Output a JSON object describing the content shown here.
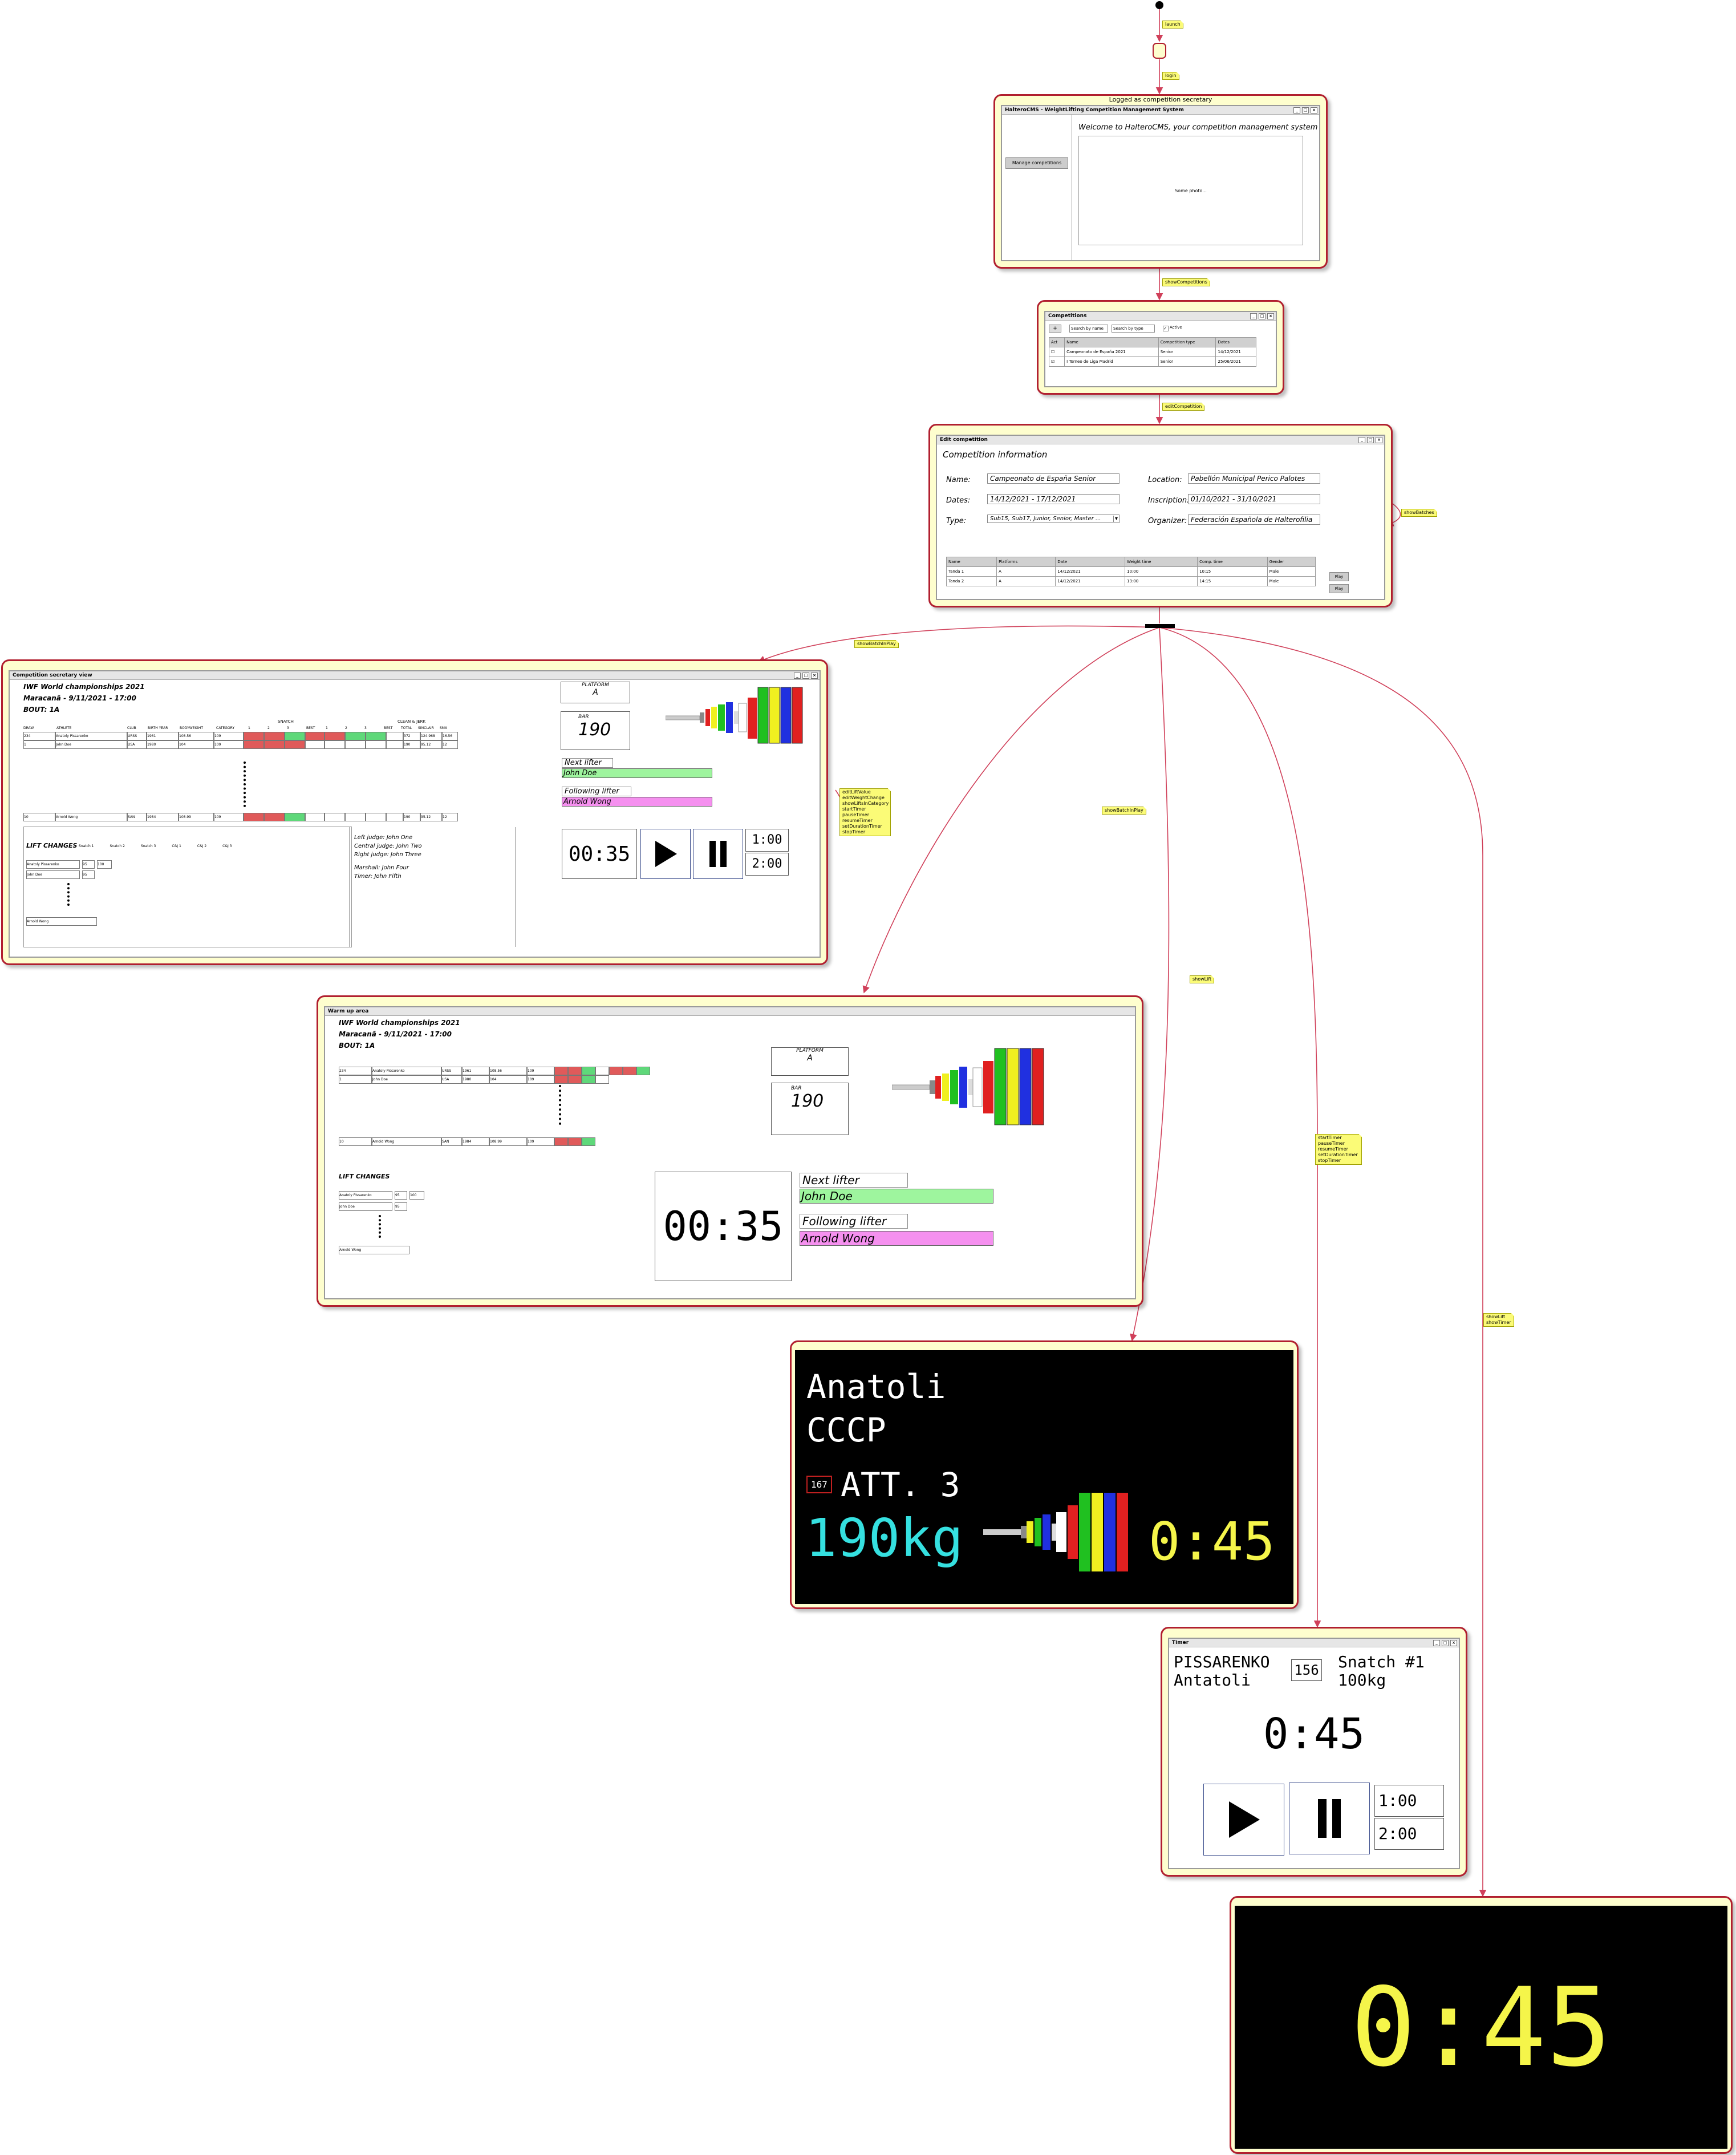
{
  "flow": {
    "notes": {
      "launch": "launch",
      "login": "login",
      "showCompetitions": "showCompetitions",
      "editCompetition": "editCompetition",
      "showBatches": "showBatches",
      "showBatchInPlay_1": "showBatchInPlay",
      "showBatchInPlay_2": "showBatchInPlay",
      "showLift": "showLift",
      "secretary_events": [
        "editLiftValue",
        "editWeightChange",
        "showLiftsInCategory",
        "startTimer",
        "pauseTimer",
        "resumeTimer",
        "setDurationTimer",
        "stopTimer"
      ],
      "timer_events": [
        "startTimer",
        "pauseTimer",
        "resumeTimer",
        "setDurationTimer",
        "stopTimer"
      ],
      "lift_timer_events": [
        "showLift",
        "showTimer"
      ]
    },
    "logged_state_title": "Logged as competition secretary"
  },
  "home_window": {
    "title": "HalteroCMS - WeightLifting Competition Management System",
    "manage_button": "Manage competitions",
    "welcome": "Welcome to HalteroCMS, your competition management system",
    "photo_placeholder": "Some photo..."
  },
  "competitions_window": {
    "title": "Competitions",
    "add_button": "+",
    "search_name": "Search by name",
    "search_type": "Search by type",
    "filter_label": "Active",
    "columns": [
      "Act",
      "Name",
      "Competition type",
      "Dates"
    ],
    "rows": [
      {
        "name": "Campeonato de España 2021",
        "type": "Senior",
        "dates": "14/12/2021"
      },
      {
        "name": "I Torneo de Liga Madrid",
        "type": "Senior",
        "dates": "25/06/2021"
      }
    ]
  },
  "edit_window": {
    "title": "Edit competition",
    "heading": "Competition information",
    "name_label": "Name:",
    "name_value": "Campeonato de España Senior",
    "dates_label": "Dates:",
    "dates_value": "14/12/2021 - 17/12/2021",
    "type_label": "Type:",
    "type_value": "Sub15, Sub17, Junior, Senior, Master ...",
    "location_label": "Location:",
    "location_value": "Pabellón Municipal Perico Palotes",
    "inscription_label": "Inscription:",
    "inscription_value": "01/10/2021 - 31/10/2021",
    "organizer_label": "Organizer:",
    "organizer_value": "Federación Española de Halterofilia",
    "batch_columns": [
      "Name",
      "Platforms",
      "Date",
      "Weight time",
      "Comp. time",
      "Gender"
    ],
    "batches": [
      {
        "name": "Tanda 1",
        "platforms": "A",
        "date": "14/12/2021",
        "weight": "10:00",
        "comp": "10:15",
        "gender": "Male",
        "action": "Play"
      },
      {
        "name": "Tanda 2",
        "platforms": "A",
        "date": "14/12/2021",
        "weight": "13:00",
        "comp": "14:15",
        "gender": "Male",
        "action": "Play"
      }
    ]
  },
  "secretary_view": {
    "title": "Competition secretary view",
    "event": "IWF World championships 2021",
    "place": "Maracanã - 9/11/2021 - 17:00",
    "bout": "BOUT:  1A",
    "group_snatch": "SNATCH",
    "group_cj": "CLEAN & JERK",
    "columns": [
      "DRAW",
      "ATHLETE",
      "CLUB",
      "BIRTH YEAR",
      "BODYWEIGHT",
      "CATEGORY",
      "1",
      "2",
      "3",
      "BEST",
      "1",
      "2",
      "3",
      "BEST",
      "TOTAL",
      "SINCLAIR",
      "SMA"
    ],
    "rows": [
      {
        "draw": "234",
        "athlete": "Anatoly Pissarenko",
        "club": "URSS",
        "year": "1961",
        "bw": "108.56",
        "cat": "109",
        "total": "372",
        "sinclair": "124.968",
        "sma": "16.56"
      },
      {
        "draw": "1",
        "athlete": "John Doe",
        "club": "USA",
        "year": "1980",
        "bw": "104",
        "cat": "109",
        "total": "190",
        "sinclair": "95.12",
        "sma": "12"
      },
      {
        "draw": "10",
        "athlete": "Arnold Wong",
        "club": "SAN",
        "year": "1984",
        "bw": "108.99",
        "cat": "109",
        "total": "190",
        "sinclair": "95.12",
        "sma": "12"
      }
    ],
    "platform_label": "PLATFORM",
    "platform_value": "A",
    "bar_label": "BAR",
    "bar_value": "190",
    "next_label": "Next lifter",
    "next_value": "John Doe",
    "following_label": "Following lifter",
    "following_value": "Arnold Wong",
    "timer": "00:35",
    "dur1": "1:00",
    "dur2": "2:00",
    "lift_changes": "LIFT CHANGES",
    "lc_cols": [
      "Snatch 1",
      "Snatch 2",
      "Snatch 3",
      "C&J 1",
      "C&J 2",
      "C&J 3"
    ],
    "lc_rows": [
      {
        "name": "Anatoly Pissarenko",
        "v": "95",
        "w": "100"
      },
      {
        "name": "John Doe",
        "v": "95",
        "w": ""
      },
      {
        "name": "Arnold Wong",
        "v": "",
        "w": ""
      }
    ],
    "officials": [
      "Left judge:    John One",
      "Central judge:    John Two",
      "Right judge:    John Three",
      "Marshall:    John Four",
      "Timer:    John Fifth"
    ]
  },
  "warmup_view": {
    "title": "Warm up area",
    "event": "IWF World championships 2021",
    "place": "Maracanã - 9/11/2021 - 17:00",
    "bout": "BOUT:  1A",
    "platform_label": "PLATFORM",
    "platform_value": "A",
    "bar_label": "BAR",
    "bar_value": "190",
    "lift_changes": "LIFT CHANGES",
    "timer": "00:35",
    "next_label": "Next lifter",
    "next_value": "John Doe",
    "following_label": "Following lifter",
    "following_value": "Arnold Wong"
  },
  "lift_display": {
    "first_name": "Anatoli",
    "country": "CCCP",
    "start_number": "167",
    "attempt": "ATT. 3",
    "weight": "190kg",
    "clock": "0:45"
  },
  "timer_window": {
    "title": "Timer",
    "last_name": "PISSARENKO",
    "first_name": "Antatoli",
    "number": "156",
    "lift": "Snatch #1",
    "weight": "100kg",
    "clock": "0:45",
    "dur1": "1:00",
    "dur2": "2:00"
  },
  "big_clock": {
    "clock": "0:45"
  },
  "colors": {
    "note": "#fbfb77",
    "frame": "#fefece",
    "arrow": "#d0405a",
    "good": "#5fd87a",
    "bad": "#e05a5a",
    "next": "#9ef59e",
    "following": "#f590ef",
    "cyan": "#35e0e0",
    "yellow": "#f5f54a"
  }
}
